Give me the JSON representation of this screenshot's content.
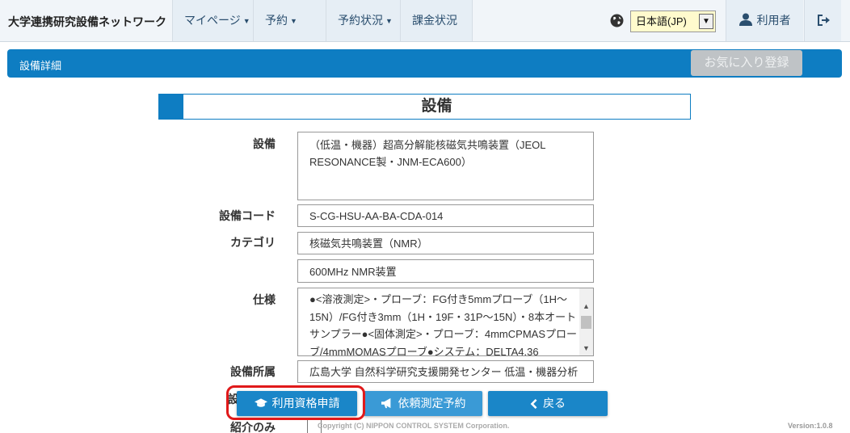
{
  "navbar": {
    "brand": "大学連携研究設備ネットワーク",
    "items": [
      {
        "label": "マイページ",
        "caret": "▼"
      },
      {
        "label": "予約",
        "caret": "▼"
      },
      {
        "label": "予約状況",
        "caret": "▼"
      },
      {
        "label": "課金状況",
        "caret": ""
      }
    ],
    "language": "日本語(JP)",
    "user_label": "利用者"
  },
  "header": {
    "title": "設備詳細",
    "favorite_button": "お気に入り登録"
  },
  "section": {
    "heading": "設備"
  },
  "form": {
    "equipment_label": "設備",
    "equipment_value": "（低温・機器）超高分解能核磁気共鳴装置（JEOL RESONANCE製・JNM-ECA600）",
    "code_label": "設備コード",
    "code_value": "S-CG-HSU-AA-BA-CDA-014",
    "category_label": "カテゴリ",
    "category_value1": "核磁気共鳴装置（NMR）",
    "category_value2": "600MHz NMR装置",
    "spec_label": "仕様",
    "spec_value": "●<溶液測定>・プローブ：FG付き5mmプローブ（1H～15N）/FG付き3mm（1H・19F・31P～15N）・8本オートサンプラー●<固体測定>・プローブ：4mmCPMASプローブ/4mmMQMASプローブ●システム：DELTA4.36",
    "affiliation_label": "設備所属",
    "affiliation_value": "広島大学 自然科学研究支援開発センター 低温・機器分析",
    "partial_label": "設",
    "intro_label": "紹介のみ"
  },
  "actions": {
    "apply_label": "利用資格申請",
    "request_label": "依頼測定予約",
    "back_label": "戻る"
  },
  "footer": {
    "copyright": "Copyright (C) NIPPON CONTROL SYSTEM Corporation.",
    "version": "Version:1.0.8"
  },
  "colors": {
    "accent": "#0e7dc2",
    "highlight": "#e0191a",
    "language_bg": "#fffacd"
  }
}
